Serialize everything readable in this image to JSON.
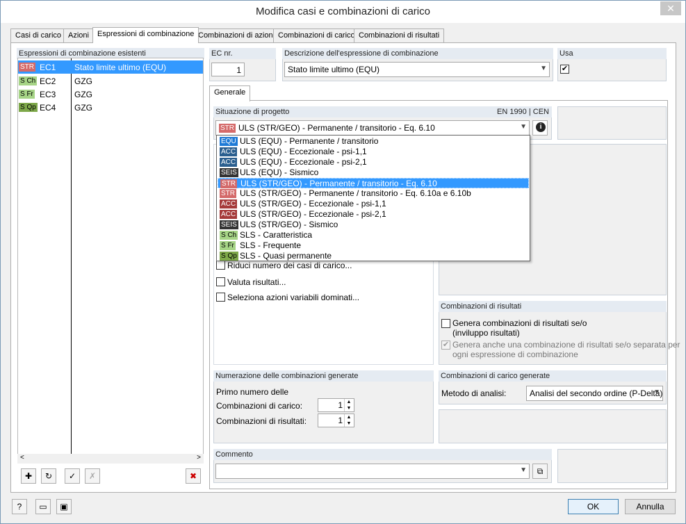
{
  "window": {
    "title": "Modifica casi e combinazioni di carico"
  },
  "tabs": [
    {
      "label": "Casi di carico"
    },
    {
      "label": "Azioni"
    },
    {
      "label": "Espressioni di combinazione"
    },
    {
      "label": "Combinazioni di azioni"
    },
    {
      "label": "Combinazioni di carico"
    },
    {
      "label": "Combinazioni di risultati"
    }
  ],
  "left": {
    "header": "Espressioni di combinazione esistenti",
    "rows": [
      {
        "badge": "STR",
        "id": "EC1",
        "desc": "Stato limite ultimo (EQU)"
      },
      {
        "badge": "S Ch",
        "id": "EC2",
        "desc": "GZG"
      },
      {
        "badge": "S Fr",
        "id": "EC3",
        "desc": "GZG"
      },
      {
        "badge": "S Qp",
        "id": "EC4",
        "desc": "GZG"
      }
    ]
  },
  "ec": {
    "header": "EC nr.",
    "value": "1"
  },
  "desc": {
    "header": "Descrizione dell'espressione di combinazione",
    "value": "Stato limite ultimo (EQU)"
  },
  "usa": {
    "header": "Usa",
    "checked": "✔"
  },
  "subtab": {
    "label": "Generale"
  },
  "situazione": {
    "header": "Situazione di progetto",
    "norm": "EN 1990 | CEN",
    "selected_badge": "STR",
    "selected": "ULS (STR/GEO) - Permanente / transitorio - Eq. 6.10",
    "options": [
      {
        "badge": "EQU",
        "label": "ULS (EQU) - Permanente / transitorio"
      },
      {
        "badge": "ACC",
        "label": "ULS (EQU) - Eccezionale - psi-1,1"
      },
      {
        "badge": "ACC",
        "label": "ULS (EQU) - Eccezionale - psi-2,1"
      },
      {
        "badge": "SEIS",
        "label": "ULS (EQU) - Sismico"
      },
      {
        "badge": "STR",
        "label": "ULS (STR/GEO) - Permanente / transitorio - Eq. 6.10"
      },
      {
        "badge": "STR",
        "label": "ULS (STR/GEO) - Permanente / transitorio - Eq. 6.10a e 6.10b"
      },
      {
        "badge": "ACC",
        "label": "ULS (STR/GEO) - Eccezionale - psi-1,1"
      },
      {
        "badge": "ACC",
        "label": "ULS (STR/GEO) - Eccezionale - psi-2,1"
      },
      {
        "badge": "SEIS",
        "label": "ULS (STR/GEO) - Sismico"
      },
      {
        "badge": "S Ch",
        "label": "SLS - Caratteristica"
      },
      {
        "badge": "S Fr",
        "label": "SLS - Frequente"
      },
      {
        "badge": "S Qp",
        "label": "SLS - Quasi permanente"
      }
    ]
  },
  "options": {
    "riduci": "Riduci numero dei casi di carico...",
    "valuta": "Valuta risultati...",
    "seleziona": "Seleziona azioni variabili dominati..."
  },
  "combo_risultati": {
    "header": "Combinazioni di risultati",
    "genera": "Genera combinazioni di risultati se/o",
    "genera2": "(inviluppo risultati)",
    "genera_sep": "Genera anche una combinazione di risultati se/o separata per",
    "genera_sep2": "ogni espressione di combinazione",
    "checked": "✔"
  },
  "numerazione": {
    "header": "Numerazione delle combinazioni generate",
    "primo": "Primo numero delle",
    "carico_label": "Combinazioni di carico:",
    "carico_value": "1",
    "risultati_label": "Combinazioni di risultati:",
    "risultati_value": "1"
  },
  "combo_carico": {
    "header": "Combinazioni di carico generate",
    "metodo_label": "Metodo di analisi:",
    "metodo_value": "Analisi del secondo ordine (P-Delta)"
  },
  "commento": {
    "header": "Commento",
    "value": ""
  },
  "footer": {
    "ok": "OK",
    "annulla": "Annulla"
  },
  "icons": {
    "close": "✕",
    "dropdown": "▼",
    "up": "▲",
    "down": "▼",
    "info": "i",
    "scroll_left": "<",
    "scroll_right": ">",
    "new": "✚",
    "cb": "↻",
    "checklist": "✓",
    "uncheck": "✗",
    "delete": "✖",
    "help": "?",
    "open": "▭",
    "save": "▣",
    "copy": "⧉"
  }
}
